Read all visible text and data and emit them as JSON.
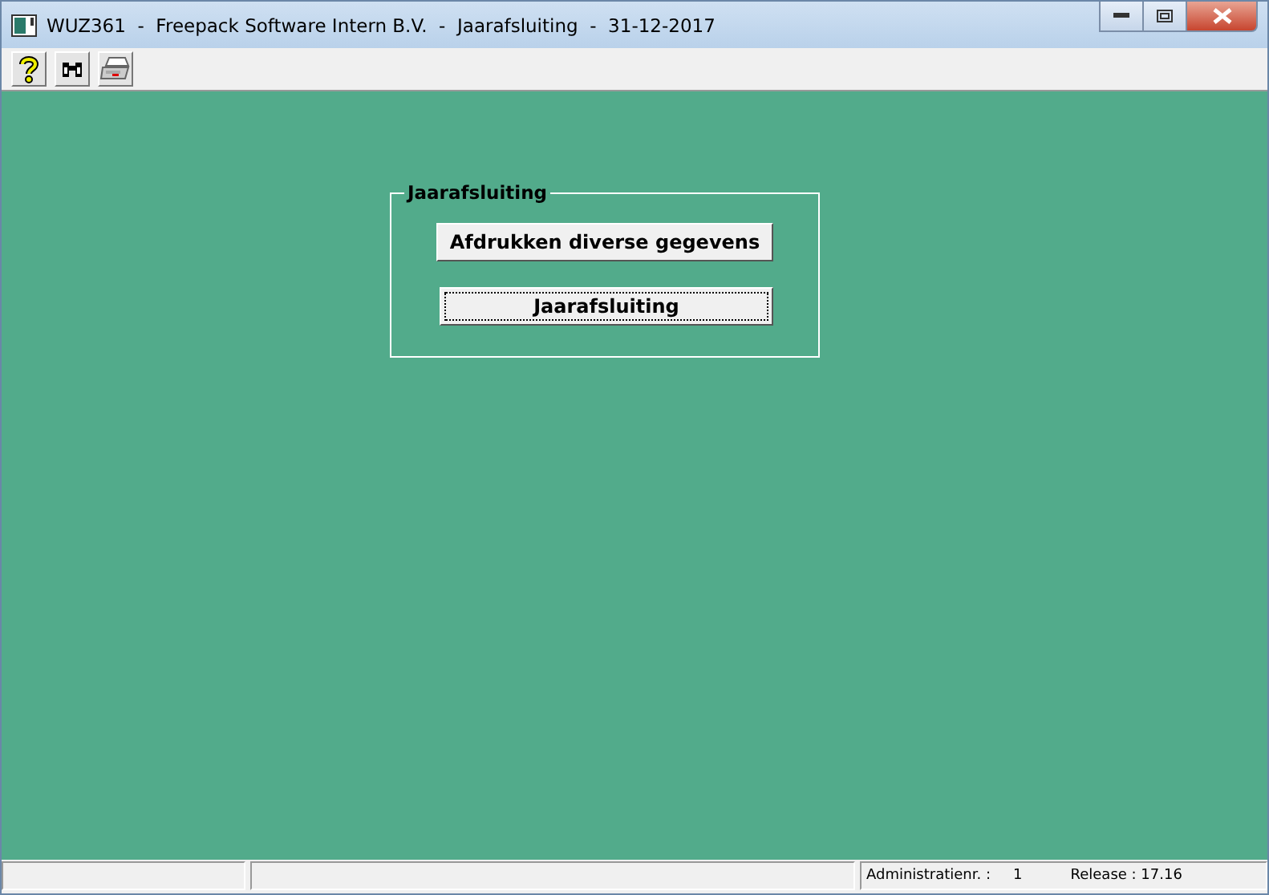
{
  "window": {
    "title": "WUZ361  -  Freepack Software Intern B.V.  -  Jaarafsluiting  -  31-12-2017"
  },
  "toolbar": [
    {
      "kind": "help"
    },
    {
      "kind": "binoculars"
    },
    {
      "kind": "printer"
    }
  ],
  "group": {
    "title": "Jaarafsluiting",
    "buttons": [
      {
        "label": "Afdrukken diverse gegevens",
        "focused": false
      },
      {
        "label": "Jaarafsluiting",
        "focused": true
      }
    ]
  },
  "status_bar": {
    "admin_label": "Administratienr. :",
    "admin_value": "1",
    "release": "Release : 17.16"
  }
}
